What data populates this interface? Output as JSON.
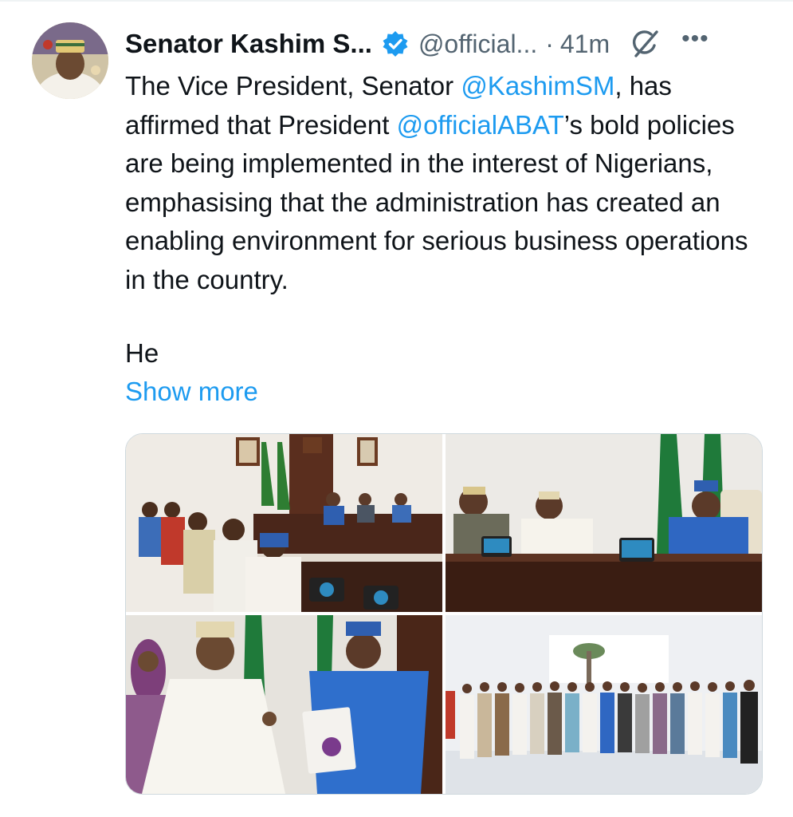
{
  "tweet": {
    "author_name": "Senator Kashim S...",
    "handle": "@official...",
    "separator": "·",
    "time": "41m",
    "body": {
      "part1": "The Vice President, Senator ",
      "mention1": "@KashimSM",
      "part2": ", has affirmed that President ",
      "mention2": "@officialABAT",
      "part3": "’s bold policies are being implemented in the interest of Nigerians, emphasising that the administration has created an enabling environment for serious business operations in the country."
    },
    "paragraph2": "He",
    "show_more": "Show more",
    "more_menu": "•••"
  },
  "icons": {
    "verified": "verified-badge-icon",
    "grok": "grok-icon",
    "more": "more-options-icon"
  },
  "colors": {
    "link": "#1d9bf0",
    "secondary_text": "#536471",
    "primary_text": "#0f1419",
    "verified": "#1d9bf0"
  }
}
